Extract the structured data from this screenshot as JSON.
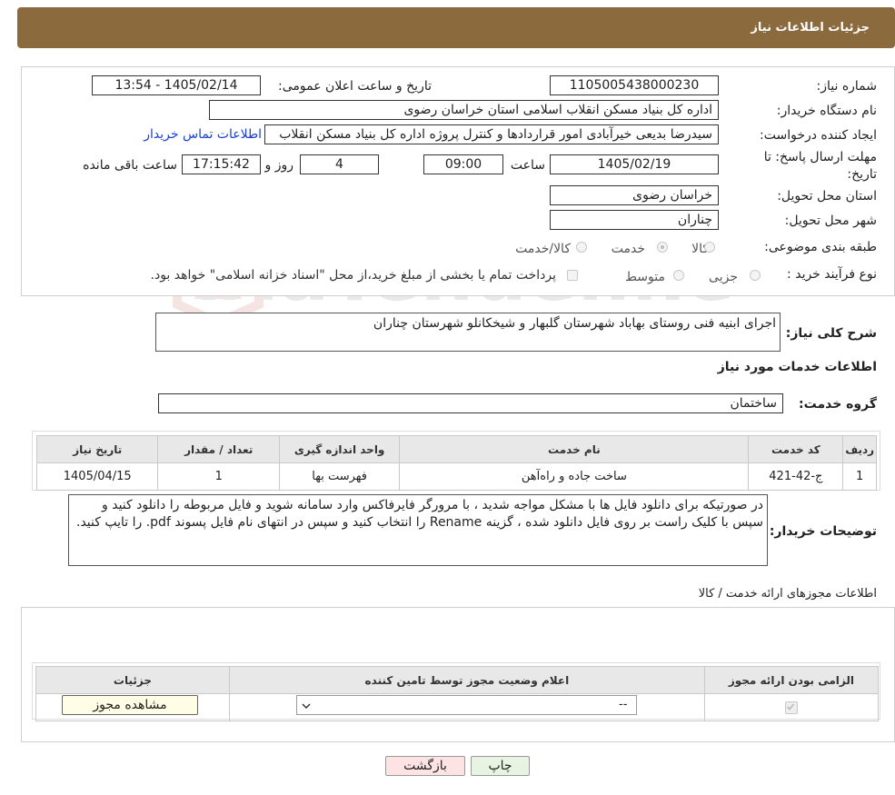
{
  "header": {
    "title": "جزئیات اطلاعات نیاز"
  },
  "form": {
    "need_number_label": "شماره نیاز:",
    "need_number": "1105005438000230",
    "announce_label": "تاریخ و ساعت اعلان عمومی:",
    "announce_value": "1405/02/14 - 13:54",
    "buyer_org_label": "نام دستگاه خریدار:",
    "buyer_org": "اداره کل بنیاد مسکن انقلاب اسلامی استان خراسان رضوی",
    "creator_label": "ایجاد کننده درخواست:",
    "creator": "سیدرضا بدیعی خیرآبادی امور قراردادها و کنترل پروژه اداره کل بنیاد مسکن انقلاب",
    "contact_link": "اطلاعات تماس خریدار",
    "deadline_label": "مهلت ارسال پاسخ: تا تاریخ:",
    "deadline_date": "1405/02/19",
    "time_label": "ساعت",
    "deadline_time": "09:00",
    "days_value": "4",
    "days_label": "روز و",
    "remaining_time": "17:15:42",
    "remaining_label": "ساعت باقی مانده",
    "province_label": "استان محل تحویل:",
    "province": "خراسان رضوی",
    "city_label": "شهر محل تحویل:",
    "city": "چناران",
    "category_label": "طبقه بندی موضوعی:",
    "category_options": [
      "کالا",
      "خدمت",
      "کالا/خدمت"
    ],
    "process_label": "نوع فرآیند خرید :",
    "process_options": [
      "جزیی",
      "متوسط"
    ],
    "payment_note": "پرداخت تمام یا بخشی از مبلغ خرید،از محل \"اسناد خزانه اسلامی\" خواهد بود."
  },
  "summary": {
    "label": "شرح کلی نیاز:",
    "text": "اجرای ابنیه فنی روستای بهاباد شهرستان گلبهار و شیخکانلو شهرستان چناران"
  },
  "services": {
    "section_title": "اطلاعات خدمات مورد نیاز",
    "group_label": "گروه خدمت:",
    "group_value": "ساختمان",
    "columns": [
      "ردیف",
      "کد خدمت",
      "نام خدمت",
      "واحد اندازه گیری",
      "تعداد / مقدار",
      "تاریخ نیاز"
    ],
    "rows": [
      [
        "1",
        "ج-42-421",
        "ساخت جاده و راه‌آهن",
        "فهرست بها",
        "1",
        "1405/04/15"
      ]
    ]
  },
  "buyer_notes": {
    "label": "توضیحات خریدار:",
    "text": "در صورتیکه برای دانلود فایل ها با مشکل مواجه شدید ، با مرورگر فایرفاکس وارد سامانه شوید و فایل مربوطه را دانلود کنید و سپس با کلیک راست بر روی فایل دانلود شده ، گزینه Rename را انتخاب کنید و سپس در انتهای نام فایل پسوند pdf. را تایپ کنید."
  },
  "permits": {
    "section_title": "اطلاعات مجوزهای ارائه خدمت / کالا",
    "columns": [
      "الزامی بودن ارائه مجوز",
      "اعلام وضعیت مجوز توسط تامین کننده",
      "جزئیات"
    ],
    "select_value": "--",
    "view_button": "مشاهده مجوز"
  },
  "actions": {
    "print": "چاپ",
    "back": "بازگشت"
  },
  "watermark": {
    "text": "AriaTender.neT"
  },
  "colors": {
    "header": "#8b6a3e",
    "link": "#1a3fd0",
    "back_button": "#fde3e3",
    "print_button": "#e6f4e1"
  }
}
